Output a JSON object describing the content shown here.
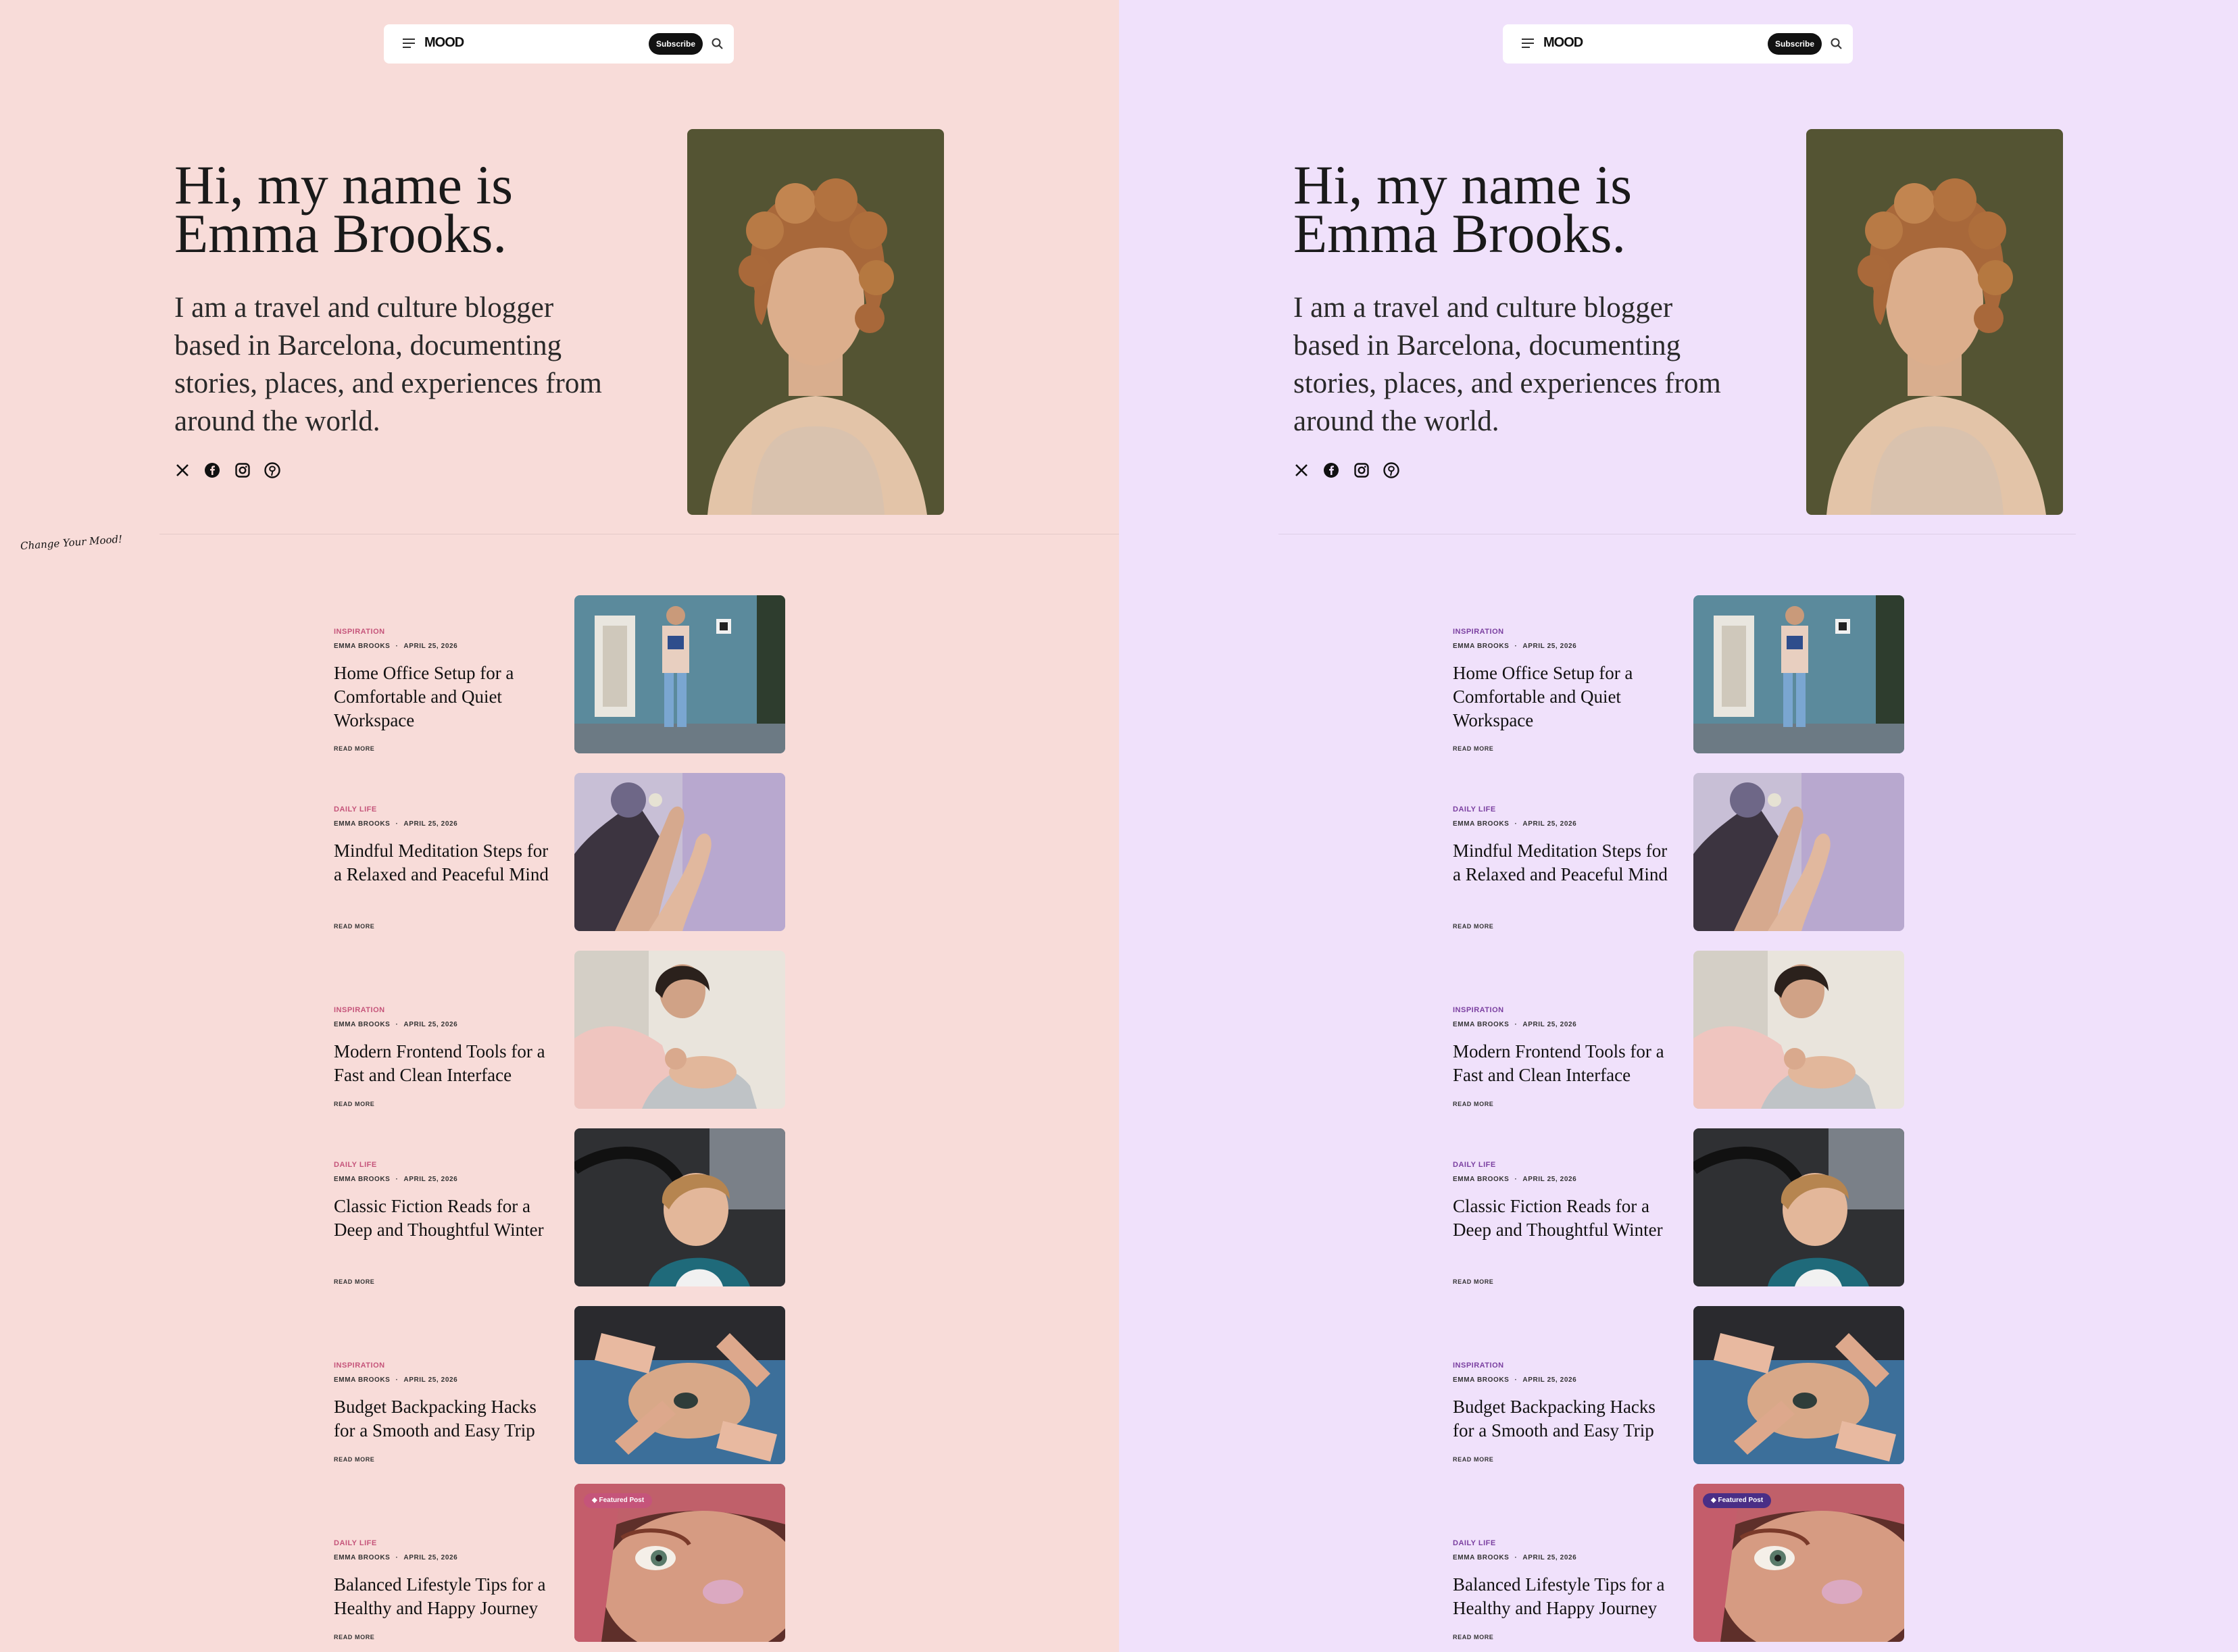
{
  "themes": [
    {
      "id": "rose",
      "bg": "#f8dcd9",
      "accent": "#c5547a",
      "badge": "#c5547a"
    },
    {
      "id": "lilac",
      "bg": "#f0e1fb",
      "accent": "#7a3fa0",
      "badge": "#4a2e86"
    }
  ],
  "nav": {
    "logo": "MOOD",
    "subscribe_label": "Subscribe"
  },
  "hero": {
    "title_line1": "Hi, my name is",
    "title_line2": "Emma Brooks.",
    "bio": "I am a travel and culture blogger based in Barcelona, documenting stories, places, and experiences from around the world.",
    "socials": [
      "x-icon",
      "facebook-icon",
      "instagram-icon",
      "pinterest-icon"
    ]
  },
  "mood_tag": "Change Your Mood!",
  "posts": [
    {
      "category": "INSPIRATION",
      "author": "EMMA BROOKS",
      "date": "APRIL 25, 2026",
      "title": "Home Office Setup for a Comfortable and Quiet Workspace",
      "read_more": "READ MORE"
    },
    {
      "category": "DAILY LIFE",
      "author": "EMMA BROOKS",
      "date": "APRIL 25, 2026",
      "title": "Mindful Meditation Steps for a Relaxed and Peaceful Mind",
      "read_more": "READ MORE"
    },
    {
      "category": "INSPIRATION",
      "author": "EMMA BROOKS",
      "date": "APRIL 25, 2026",
      "title": "Modern Frontend Tools for a Fast and Clean Interface",
      "read_more": "READ MORE"
    },
    {
      "category": "DAILY LIFE",
      "author": "EMMA BROOKS",
      "date": "APRIL 25, 2026",
      "title": "Classic Fiction Reads for a Deep and Thoughtful Winter",
      "read_more": "READ MORE"
    },
    {
      "category": "INSPIRATION",
      "author": "EMMA BROOKS",
      "date": "APRIL 25, 2026",
      "title": "Budget Backpacking Hacks for a Smooth and Easy Trip",
      "read_more": "READ MORE"
    },
    {
      "category": "DAILY LIFE",
      "author": "EMMA BROOKS",
      "date": "APRIL 25, 2026",
      "title": "Balanced Lifestyle Tips for a Healthy and Happy Journey",
      "read_more": "READ MORE",
      "badge": "Featured Post"
    }
  ]
}
